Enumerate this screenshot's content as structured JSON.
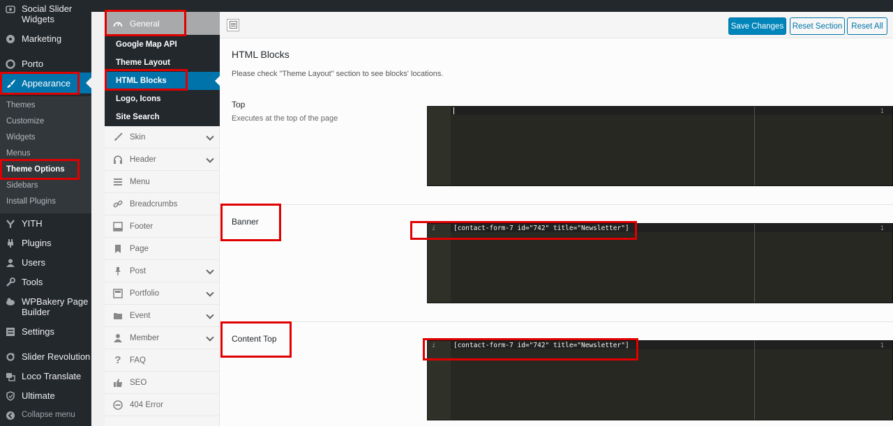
{
  "wp_menu": {
    "items": [
      {
        "label": "Social Slider Widgets",
        "icon": "slider-icon"
      },
      {
        "label": "Marketing",
        "icon": "marketing-icon"
      },
      {
        "label": "Porto",
        "icon": "porto-icon"
      },
      {
        "label": "Appearance",
        "icon": "paintbrush-icon"
      },
      {
        "label": "YITH",
        "icon": "yith-icon"
      },
      {
        "label": "Plugins",
        "icon": "plugin-icon"
      },
      {
        "label": "Users",
        "icon": "users-icon"
      },
      {
        "label": "Tools",
        "icon": "wrench-icon"
      },
      {
        "label": "WPBakery Page Builder",
        "icon": "wpbakery-icon"
      },
      {
        "label": "Settings",
        "icon": "settings-icon"
      },
      {
        "label": "Slider Revolution",
        "icon": "refresh-icon"
      },
      {
        "label": "Loco Translate",
        "icon": "translate-icon"
      },
      {
        "label": "Ultimate",
        "icon": "shield-icon"
      },
      {
        "label": "Collapse menu",
        "icon": "collapse-icon"
      }
    ],
    "appearance_submenu": [
      "Themes",
      "Customize",
      "Widgets",
      "Menus",
      "Theme Options",
      "Sidebars",
      "Install Plugins"
    ]
  },
  "options_nav": {
    "general": "General",
    "general_sub": [
      "Google Map API",
      "Theme Layout",
      "HTML Blocks",
      "Logo, Icons",
      "Site Search"
    ],
    "sections": [
      {
        "label": "Skin",
        "icon": "brush-icon"
      },
      {
        "label": "Header",
        "icon": "headphones-icon"
      },
      {
        "label": "Menu",
        "icon": "menu-icon"
      },
      {
        "label": "Breadcrumbs",
        "icon": "link-icon"
      },
      {
        "label": "Footer",
        "icon": "footer-icon"
      },
      {
        "label": "Page",
        "icon": "bookmark-icon"
      },
      {
        "label": "Post",
        "icon": "pushpin-icon"
      },
      {
        "label": "Portfolio",
        "icon": "portfolio-icon"
      },
      {
        "label": "Event",
        "icon": "folder-icon"
      },
      {
        "label": "Member",
        "icon": "person-icon"
      },
      {
        "label": "FAQ",
        "icon": "question-icon"
      },
      {
        "label": "SEO",
        "icon": "thumbs-up-icon"
      },
      {
        "label": "404 Error",
        "icon": "minus-circle-icon"
      }
    ]
  },
  "toolbar": {
    "save": "Save Changes",
    "reset_section": "Reset Section",
    "reset_all": "Reset All"
  },
  "main": {
    "title": "HTML Blocks",
    "description": "Please check \"Theme Layout\" section to see blocks' locations.",
    "fields": [
      {
        "label": "Top",
        "desc": "Executes at the top of the page",
        "line": "1",
        "code": ""
      },
      {
        "label": "Banner",
        "desc": "",
        "line": "1",
        "info": "i",
        "code": "[contact-form-7 id=\"742\" title=\"Newsletter\"]"
      },
      {
        "label": "Content Top",
        "desc": "",
        "line": "1",
        "info": "i",
        "code": "[contact-form-7 id=\"742\" title=\"Newsletter\"]"
      }
    ]
  },
  "colors": {
    "wp_dark": "#23282d",
    "wp_blue": "#0073aa",
    "highlight_red": "#e00000",
    "editor_bg": "#272822"
  }
}
